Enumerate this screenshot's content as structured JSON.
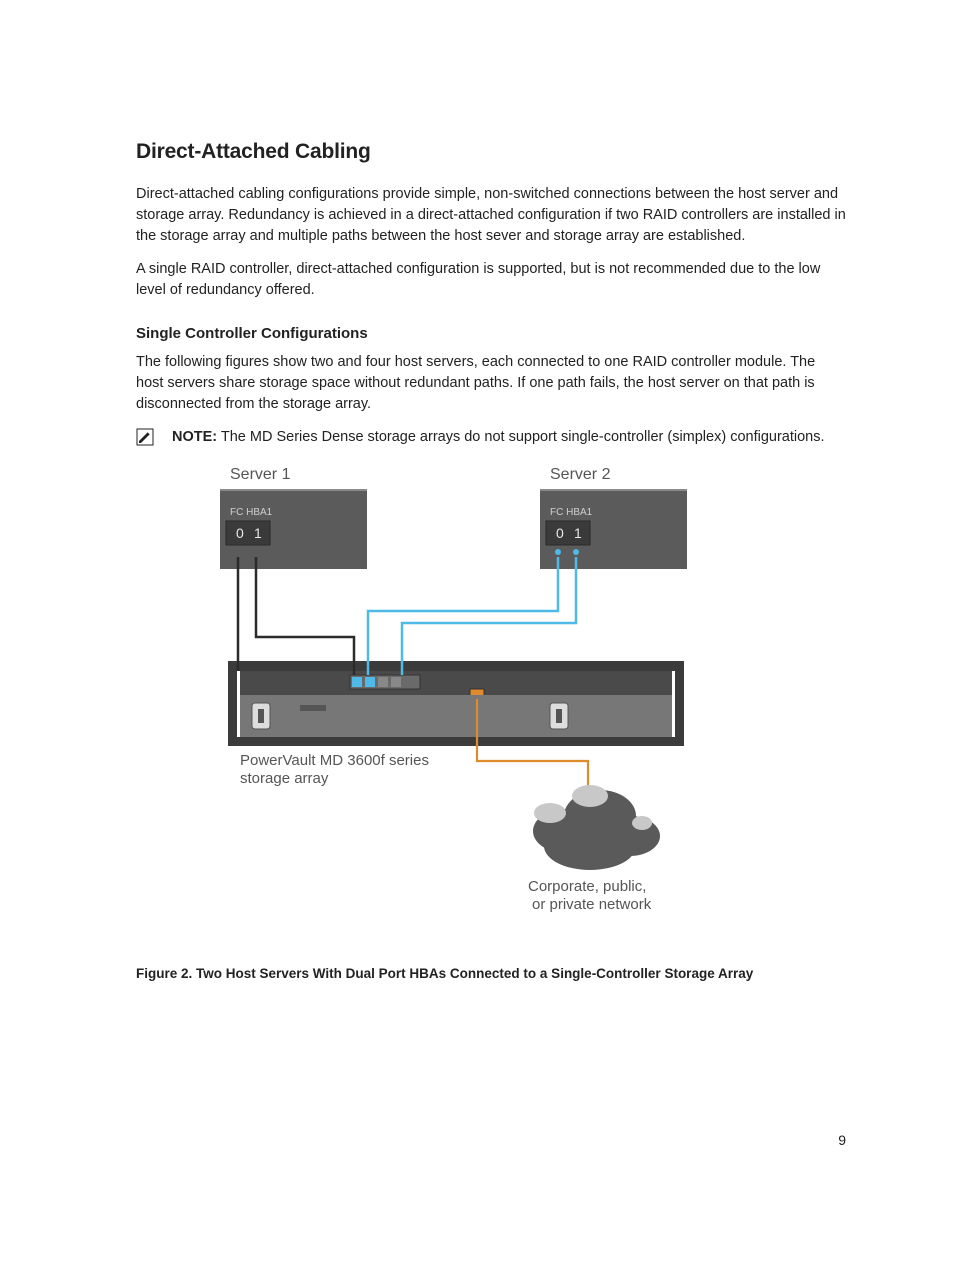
{
  "heading": "Direct-Attached Cabling",
  "para1": "Direct-attached cabling configurations provide simple, non-switched connections between the host server and storage array. Redundancy is achieved in a direct-attached configuration if two RAID controllers are installed in the storage array and multiple paths between the host sever and storage array are established.",
  "para2": "A single RAID controller, direct-attached configuration is supported, but is not recommended due to the low level of redundancy offered.",
  "subheading": "Single Controller Configurations",
  "para3": "The following figures show two and four host servers, each connected to one RAID controller module. The host servers share storage space without redundant paths. If one path fails, the host server on that path is disconnected from the storage array.",
  "note_label": "NOTE:",
  "note_text": " The MD Series Dense storage arrays do not support single-controller (simplex) configurations.",
  "figure": {
    "server1_label": "Server 1",
    "server2_label": "Server 2",
    "hba_label": "FC HBA1",
    "port0": "0",
    "port1": "1",
    "storage_label_line1": "PowerVault MD 3600f series",
    "storage_label_line2": "storage array",
    "cloud_label_line1": "Corporate, public,",
    "cloud_label_line2": "or private network"
  },
  "figure_caption": "Figure 2. Two Host Servers With Dual Port HBAs Connected to a Single-Controller Storage Array",
  "page_number": "9"
}
